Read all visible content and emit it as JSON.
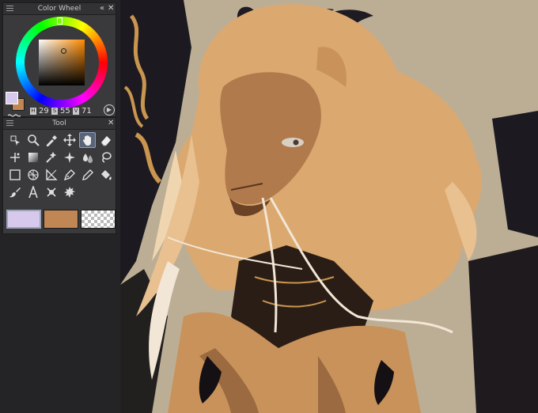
{
  "color_wheel": {
    "title": "Color Wheel",
    "hsv": [
      {
        "tag": "H",
        "value": "29"
      },
      {
        "tag": "S",
        "value": "55"
      },
      {
        "tag": "V",
        "value": "71"
      }
    ],
    "main_color": "#d7c9ec",
    "sub_color": "#c08755",
    "hue_color": "#ff8a00",
    "close_symbol": "✕",
    "collapse_symbol": "«",
    "next_symbol": "▶"
  },
  "tool_panel": {
    "title": "Tool",
    "close_symbol": "✕",
    "active_tool": "hand",
    "tools": [
      "operation",
      "zoom",
      "eyedropper",
      "move",
      "hand",
      "eraser",
      "auto-action",
      "gradient",
      "sparkle",
      "airbrush",
      "blend",
      "lasso",
      "rect-selection",
      "grid-selection",
      "ruler",
      "pen",
      "pencil",
      "fill",
      "brush",
      "text",
      "correction",
      "decoration"
    ],
    "color_bar": [
      {
        "name": "main-color",
        "color": "#d7c9ec"
      },
      {
        "name": "sub-color",
        "color": "#c08755"
      },
      {
        "name": "transparent-color",
        "color": "transparent"
      }
    ]
  },
  "palette": {
    "background": "#bcae95",
    "fur_light": "#dba86f",
    "fur_mid": "#c8925a",
    "fur_dark": "#9c6a40",
    "face": "#b07a4c",
    "horn": "#1e1b22",
    "cloth_dark": "#2a1d16",
    "gold": "#c9954f",
    "cream": "#f2e6d6"
  }
}
